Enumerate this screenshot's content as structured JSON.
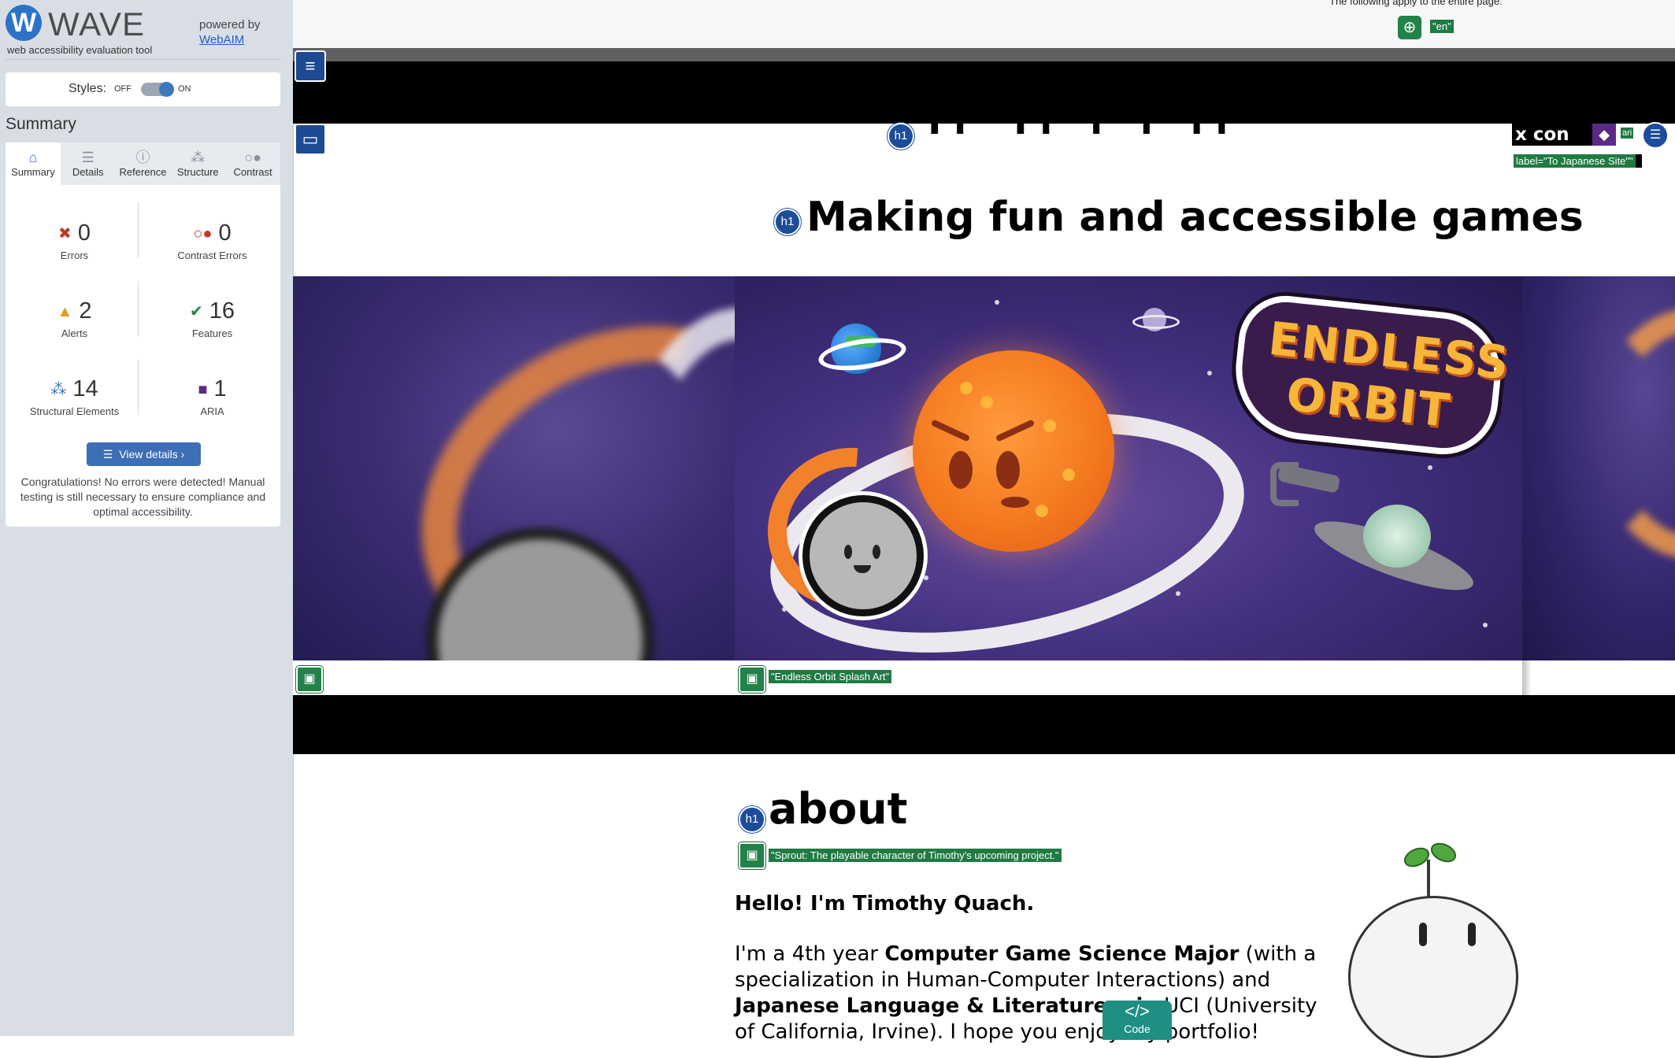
{
  "wave": {
    "logo_letter": "W",
    "name": "WAVE",
    "tagline": "web accessibility evaluation tool",
    "powered_by": "powered by",
    "powered_link": "WebAIM",
    "styles_label": "Styles:",
    "styles_off": "OFF",
    "styles_on": "ON",
    "summary_heading": "Summary",
    "tabs": [
      {
        "label": "Summary",
        "icon": "home-icon",
        "active": true
      },
      {
        "label": "Details",
        "icon": "list-icon",
        "active": false
      },
      {
        "label": "Reference",
        "icon": "info-icon",
        "active": false
      },
      {
        "label": "Structure",
        "icon": "hierarchy-icon",
        "active": false
      },
      {
        "label": "Contrast",
        "icon": "contrast-icon",
        "active": false
      }
    ],
    "stats": {
      "errors": {
        "count": "0",
        "label": "Errors"
      },
      "contrast_errors": {
        "count": "0",
        "label": "Contrast Errors"
      },
      "alerts": {
        "count": "2",
        "label": "Alerts"
      },
      "features": {
        "count": "16",
        "label": "Features"
      },
      "structural": {
        "count": "14",
        "label": "Structural Elements"
      },
      "aria": {
        "count": "1",
        "label": "ARIA"
      }
    },
    "view_details": "View details ›",
    "congrats": "Congratulations! No errors were detected! Manual testing is still necessary to ensure compliance and optimal accessibility."
  },
  "page": {
    "apply_text": "The following apply to the entire page:",
    "lang_badge": "\"en\"",
    "h1_marker": "h1",
    "nav_text": "x con",
    "aria_small": "ari",
    "aria_label_badge": "label=\"To Japanese Site\"\"",
    "hero_title": "Making fun and accessible games",
    "carousel_alt": "\"Endless Orbit Splash Art\"",
    "logo_line1": "ENDLESS",
    "logo_line2": "ORBIT",
    "about_title": "about",
    "sprout_alt": "\"Sprout: The playable character of Timothy's upcoming project.\"",
    "hello": "Hello! I'm Timothy Quach.",
    "intro_p1": "I'm a 4th year ",
    "intro_b1": "Computer Game Science Major",
    "intro_p2": " (with a specialization in Human-Computer Interactions) and ",
    "intro_b2": "Japanese Language & Literature min",
    "intro_p3": "   UCI (University of California, Irvine). I hope you enjoy my portfolio!",
    "code_label": "Code",
    "code_icon": "</>"
  },
  "colors": {
    "wave_blue": "#3d6fb6",
    "feature_green": "#23824a",
    "error_red": "#c0392b",
    "alert_orange": "#e0a21b",
    "aria_purple": "#5b2a86",
    "code_teal": "#1e8f82"
  }
}
